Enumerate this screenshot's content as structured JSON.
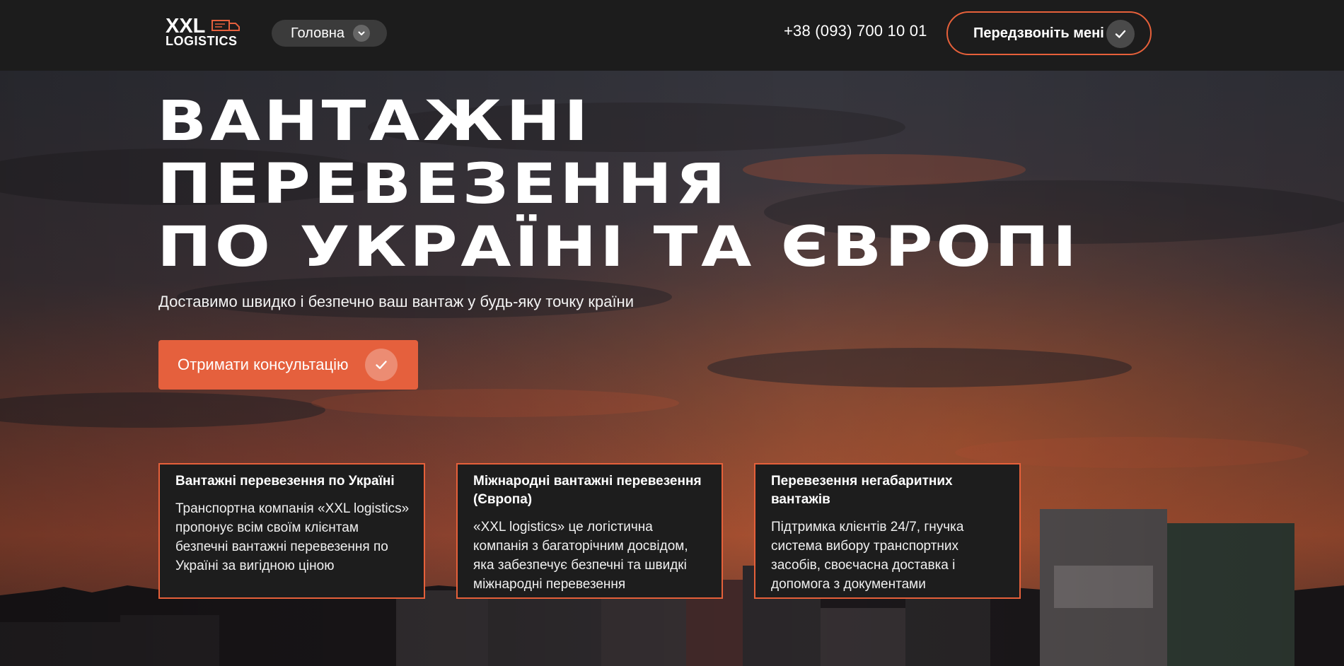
{
  "header": {
    "logo_top": "XXL",
    "logo_bottom": "LOGISTICS",
    "nav_label": "Головна",
    "phone": "+38 (093) 700 10 01",
    "callback_label": "Передзвоніть мені"
  },
  "hero": {
    "title_lines": [
      "ВАНТАЖНІ",
      "ПЕРЕВЕЗЕННЯ",
      "ПО УКРАЇНІ ТА ЄВРОПІ"
    ],
    "subtitle": "Доставимо швидко і безпечно ваш вантаж у будь-яку точку країни",
    "cta_label": "Отримати консультацію"
  },
  "cards": [
    {
      "title": "Вантажні перевезення по Україні",
      "text": "Транспортна компанія «XXL logistics» пропонує всім своїм клієнтам безпечні вантажні перевезення по Україні за вигідною ціною"
    },
    {
      "title": "Міжнародні вантажні перевезення (Європа)",
      "text": "«XXL logistics» це логістична компанія з багаторічним досвідом, яка забезпечує безпечні та швидкі міжнародні перевезення"
    },
    {
      "title": "Перевезення негабаритних вантажів",
      "text": "Підтримка клієнтів 24/7, гнучка система вибору транспортних засобів, своєчасна доставка і допомога з документами"
    }
  ],
  "colors": {
    "accent": "#e5603d",
    "header_bg": "#1c1c1c",
    "card_bg": "#1d1d1d"
  },
  "icons": {
    "nav": "chevron-down-icon",
    "callback": "check-icon",
    "cta": "check-icon",
    "logo": "truck-icon"
  }
}
